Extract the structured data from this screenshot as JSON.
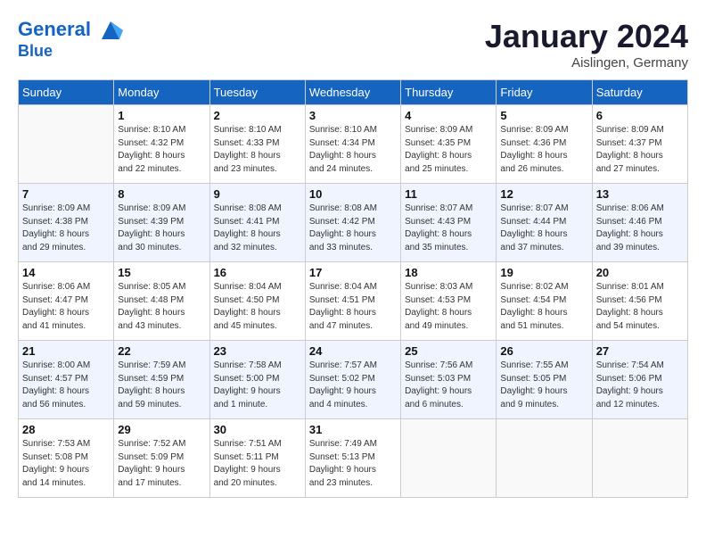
{
  "header": {
    "logo_line1": "General",
    "logo_line2": "Blue",
    "month": "January 2024",
    "location": "Aislingen, Germany"
  },
  "days_of_week": [
    "Sunday",
    "Monday",
    "Tuesday",
    "Wednesday",
    "Thursday",
    "Friday",
    "Saturday"
  ],
  "weeks": [
    [
      {
        "day": "",
        "info": ""
      },
      {
        "day": "1",
        "info": "Sunrise: 8:10 AM\nSunset: 4:32 PM\nDaylight: 8 hours\nand 22 minutes."
      },
      {
        "day": "2",
        "info": "Sunrise: 8:10 AM\nSunset: 4:33 PM\nDaylight: 8 hours\nand 23 minutes."
      },
      {
        "day": "3",
        "info": "Sunrise: 8:10 AM\nSunset: 4:34 PM\nDaylight: 8 hours\nand 24 minutes."
      },
      {
        "day": "4",
        "info": "Sunrise: 8:09 AM\nSunset: 4:35 PM\nDaylight: 8 hours\nand 25 minutes."
      },
      {
        "day": "5",
        "info": "Sunrise: 8:09 AM\nSunset: 4:36 PM\nDaylight: 8 hours\nand 26 minutes."
      },
      {
        "day": "6",
        "info": "Sunrise: 8:09 AM\nSunset: 4:37 PM\nDaylight: 8 hours\nand 27 minutes."
      }
    ],
    [
      {
        "day": "7",
        "info": "Sunrise: 8:09 AM\nSunset: 4:38 PM\nDaylight: 8 hours\nand 29 minutes."
      },
      {
        "day": "8",
        "info": "Sunrise: 8:09 AM\nSunset: 4:39 PM\nDaylight: 8 hours\nand 30 minutes."
      },
      {
        "day": "9",
        "info": "Sunrise: 8:08 AM\nSunset: 4:41 PM\nDaylight: 8 hours\nand 32 minutes."
      },
      {
        "day": "10",
        "info": "Sunrise: 8:08 AM\nSunset: 4:42 PM\nDaylight: 8 hours\nand 33 minutes."
      },
      {
        "day": "11",
        "info": "Sunrise: 8:07 AM\nSunset: 4:43 PM\nDaylight: 8 hours\nand 35 minutes."
      },
      {
        "day": "12",
        "info": "Sunrise: 8:07 AM\nSunset: 4:44 PM\nDaylight: 8 hours\nand 37 minutes."
      },
      {
        "day": "13",
        "info": "Sunrise: 8:06 AM\nSunset: 4:46 PM\nDaylight: 8 hours\nand 39 minutes."
      }
    ],
    [
      {
        "day": "14",
        "info": "Sunrise: 8:06 AM\nSunset: 4:47 PM\nDaylight: 8 hours\nand 41 minutes."
      },
      {
        "day": "15",
        "info": "Sunrise: 8:05 AM\nSunset: 4:48 PM\nDaylight: 8 hours\nand 43 minutes."
      },
      {
        "day": "16",
        "info": "Sunrise: 8:04 AM\nSunset: 4:50 PM\nDaylight: 8 hours\nand 45 minutes."
      },
      {
        "day": "17",
        "info": "Sunrise: 8:04 AM\nSunset: 4:51 PM\nDaylight: 8 hours\nand 47 minutes."
      },
      {
        "day": "18",
        "info": "Sunrise: 8:03 AM\nSunset: 4:53 PM\nDaylight: 8 hours\nand 49 minutes."
      },
      {
        "day": "19",
        "info": "Sunrise: 8:02 AM\nSunset: 4:54 PM\nDaylight: 8 hours\nand 51 minutes."
      },
      {
        "day": "20",
        "info": "Sunrise: 8:01 AM\nSunset: 4:56 PM\nDaylight: 8 hours\nand 54 minutes."
      }
    ],
    [
      {
        "day": "21",
        "info": "Sunrise: 8:00 AM\nSunset: 4:57 PM\nDaylight: 8 hours\nand 56 minutes."
      },
      {
        "day": "22",
        "info": "Sunrise: 7:59 AM\nSunset: 4:59 PM\nDaylight: 8 hours\nand 59 minutes."
      },
      {
        "day": "23",
        "info": "Sunrise: 7:58 AM\nSunset: 5:00 PM\nDaylight: 9 hours\nand 1 minute."
      },
      {
        "day": "24",
        "info": "Sunrise: 7:57 AM\nSunset: 5:02 PM\nDaylight: 9 hours\nand 4 minutes."
      },
      {
        "day": "25",
        "info": "Sunrise: 7:56 AM\nSunset: 5:03 PM\nDaylight: 9 hours\nand 6 minutes."
      },
      {
        "day": "26",
        "info": "Sunrise: 7:55 AM\nSunset: 5:05 PM\nDaylight: 9 hours\nand 9 minutes."
      },
      {
        "day": "27",
        "info": "Sunrise: 7:54 AM\nSunset: 5:06 PM\nDaylight: 9 hours\nand 12 minutes."
      }
    ],
    [
      {
        "day": "28",
        "info": "Sunrise: 7:53 AM\nSunset: 5:08 PM\nDaylight: 9 hours\nand 14 minutes."
      },
      {
        "day": "29",
        "info": "Sunrise: 7:52 AM\nSunset: 5:09 PM\nDaylight: 9 hours\nand 17 minutes."
      },
      {
        "day": "30",
        "info": "Sunrise: 7:51 AM\nSunset: 5:11 PM\nDaylight: 9 hours\nand 20 minutes."
      },
      {
        "day": "31",
        "info": "Sunrise: 7:49 AM\nSunset: 5:13 PM\nDaylight: 9 hours\nand 23 minutes."
      },
      {
        "day": "",
        "info": ""
      },
      {
        "day": "",
        "info": ""
      },
      {
        "day": "",
        "info": ""
      }
    ]
  ]
}
